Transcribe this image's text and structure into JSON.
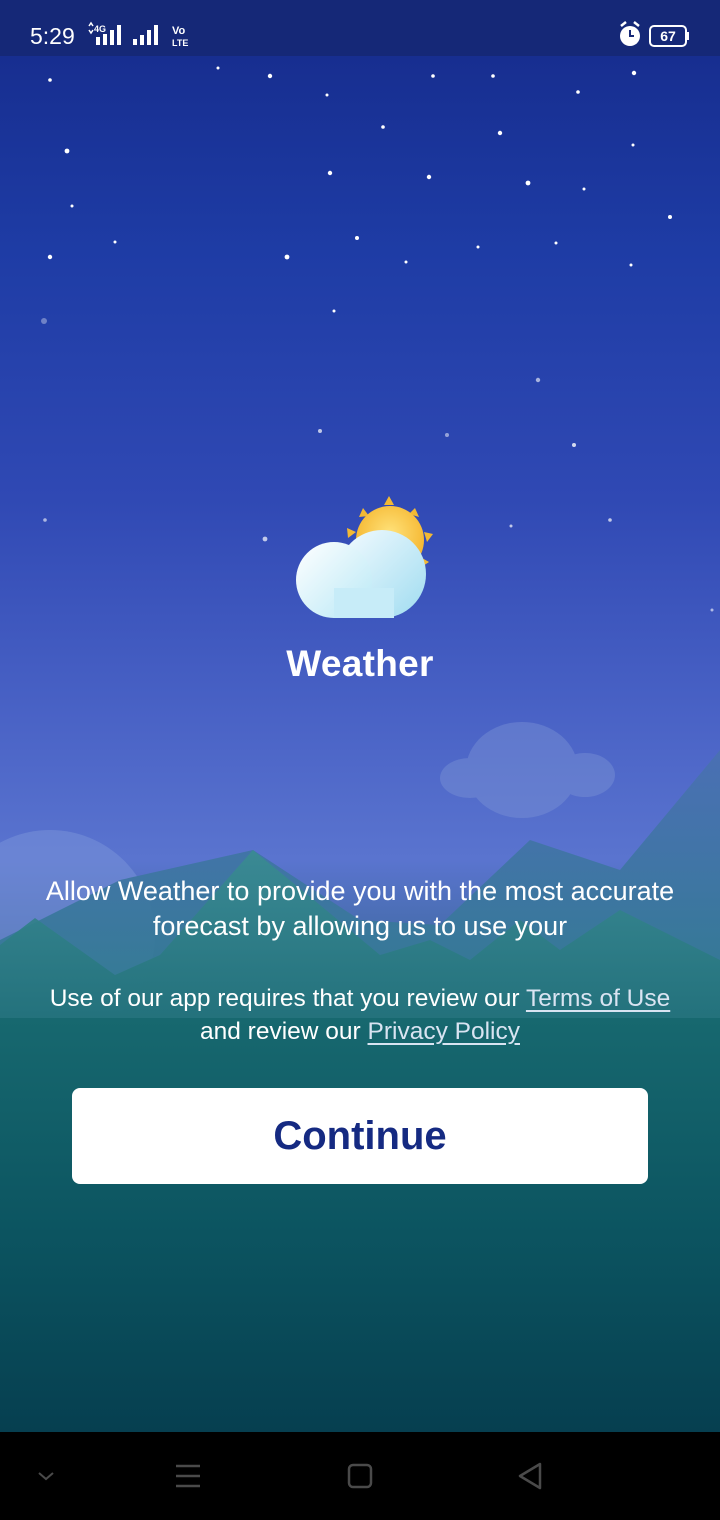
{
  "status_bar": {
    "time": "5:29",
    "network": "4G",
    "volte": "Vo LTE",
    "battery": "67",
    "icons": [
      "4g-signal-icon",
      "signal-icon",
      "volte-icon",
      "alarm-icon",
      "battery-icon"
    ]
  },
  "app": {
    "title": "Weather",
    "logo_icon": "sun-cloud-icon"
  },
  "permission": {
    "text": "Allow Weather to provide you with the most accurate forecast by allowing us to use your"
  },
  "terms": {
    "prefix": "Use of our app requires that you review our ",
    "terms_link": "Terms of Use",
    "middle": " and review our ",
    "privacy_link": "Privacy Policy"
  },
  "continue_label": "Continue",
  "nav_bar": {
    "icons": [
      "chevron-down-icon",
      "menu-icon",
      "home-icon",
      "back-icon"
    ]
  },
  "colors": {
    "button_text": "#152a82",
    "status_bar": "#152877",
    "sky_top": "#152a8a",
    "sea_bottom": "#063f50"
  }
}
